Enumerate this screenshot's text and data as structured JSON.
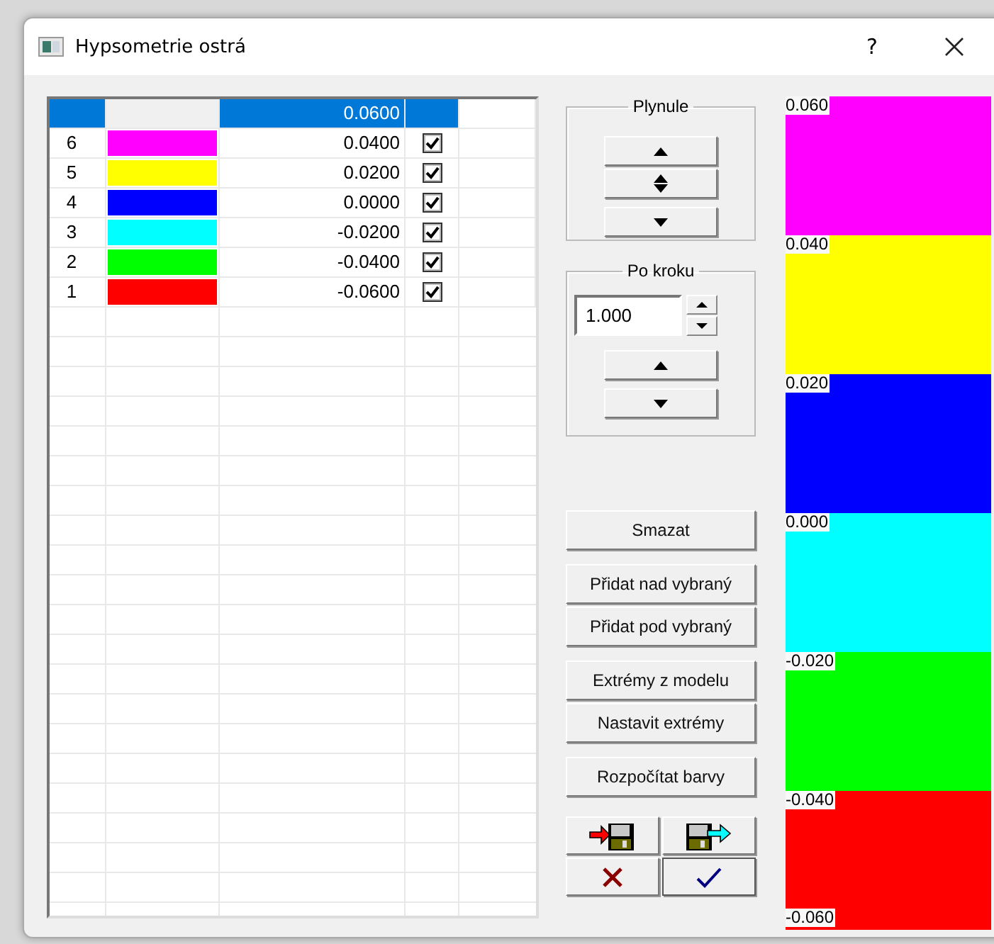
{
  "window": {
    "title": "Hypsometrie ostrá",
    "help": "?"
  },
  "table": {
    "top_row": {
      "value": "0.0600",
      "selected": true
    },
    "rows": [
      {
        "index": "6",
        "color": "#ff00ff",
        "value": "0.0400",
        "checked": true,
        "selected": false
      },
      {
        "index": "5",
        "color": "#ffff00",
        "value": "0.0200",
        "checked": true,
        "selected": false
      },
      {
        "index": "4",
        "color": "#0000ff",
        "value": "0.0000",
        "checked": true,
        "selected": false
      },
      {
        "index": "3",
        "color": "#00ffff",
        "value": "-0.0200",
        "checked": true,
        "selected": false
      },
      {
        "index": "2",
        "color": "#00ff00",
        "value": "-0.0400",
        "checked": true,
        "selected": false
      },
      {
        "index": "1",
        "color": "#ff0000",
        "value": "-0.0600",
        "checked": true,
        "selected": false
      }
    ]
  },
  "plynule": {
    "title": "Plynule"
  },
  "po_kroku": {
    "title": "Po kroku",
    "step": "1.000"
  },
  "action_groups": [
    [
      "Smazat"
    ],
    [
      "Přidat nad vybraný",
      "Přidat pod vybraný"
    ],
    [
      "Extrémy z modelu",
      "Nastavit extrémy"
    ],
    [
      "Rozpočítat barvy"
    ]
  ],
  "legend": {
    "bands": [
      {
        "label": "0.060",
        "color": "#ff00ff"
      },
      {
        "label": "0.040",
        "color": "#ffff00"
      },
      {
        "label": "0.020",
        "color": "#0000ff"
      },
      {
        "label": "0.000",
        "color": "#00ffff"
      },
      {
        "label": "-0.020",
        "color": "#00ff00"
      },
      {
        "label": "-0.040",
        "color": "#ff0000"
      }
    ],
    "bottom_label": "-0.060"
  }
}
